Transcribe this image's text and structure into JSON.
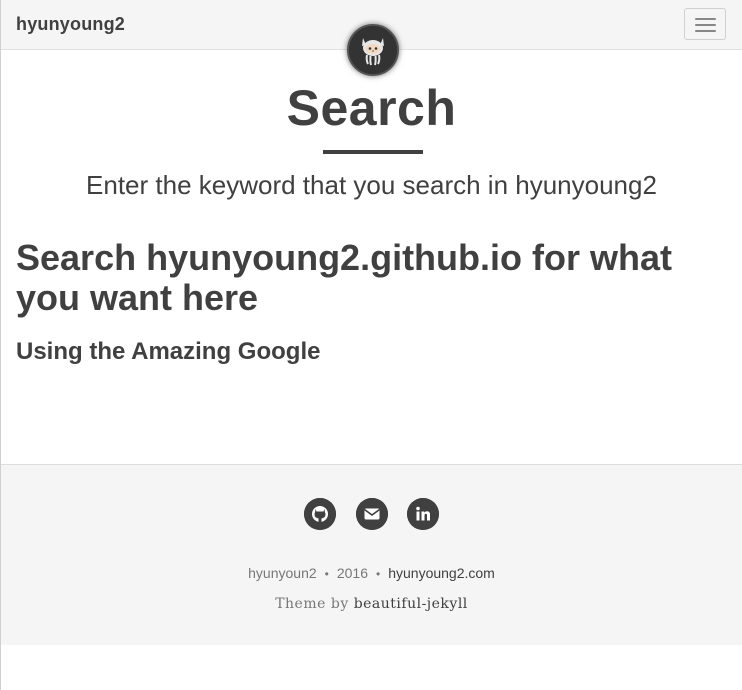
{
  "navbar": {
    "brand": "hyunyoung2"
  },
  "header": {
    "title": "Search",
    "subtitle": "Enter the keyword that you search in hyunyoung2"
  },
  "main": {
    "heading": "Search hyunyoung2.github.io for what you want here",
    "subheading": "Using the Amazing Google"
  },
  "footer": {
    "social": [
      {
        "icon": "github-icon"
      },
      {
        "icon": "email-icon"
      },
      {
        "icon": "linkedin-icon"
      }
    ],
    "author": "hyunyoun2",
    "separator": "•",
    "year": "2016",
    "site": "hyunyoung2.com",
    "theme_prefix": "Theme by",
    "theme_name": "beautiful-jekyll"
  },
  "colors": {
    "text": "#404040",
    "navbar_bg": "#f5f5f5",
    "footer_bg": "#f5f5f5",
    "muted": "#777777"
  }
}
